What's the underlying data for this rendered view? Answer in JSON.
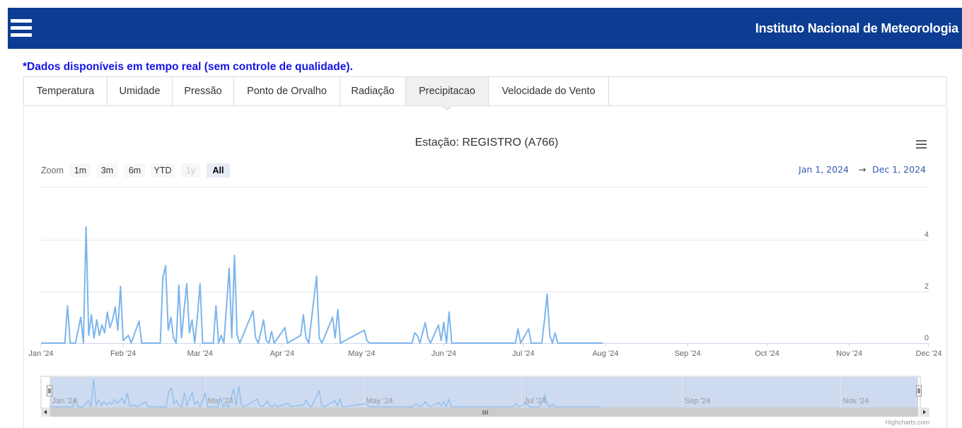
{
  "header": {
    "title": "Instituto Nacional de Meteorologia",
    "menu_icon": "hamburger-menu-icon",
    "background_color": "#0c3d92"
  },
  "notice": "*Dados disponíveis em tempo real (sem controle de qualidade).",
  "tabs": [
    {
      "label": "Temperatura",
      "active": false
    },
    {
      "label": "Umidade",
      "active": false
    },
    {
      "label": "Pressão",
      "active": false
    },
    {
      "label": "Ponto de Orvalho",
      "active": false
    },
    {
      "label": "Radiação",
      "active": false
    },
    {
      "label": "Precipitacao",
      "active": true
    },
    {
      "label": "Velocidade do Vento",
      "active": false
    }
  ],
  "chart_menu_icon": "context-menu-icon",
  "range_selector": {
    "zoom_label": "Zoom",
    "buttons": [
      "1m",
      "3m",
      "6m",
      "YTD",
      "1y",
      "All"
    ],
    "selected": "All",
    "disabled": [
      "1y"
    ]
  },
  "date_range": {
    "from": "Jan 1, 2024",
    "arrow": "→",
    "to": "Dec 1, 2024"
  },
  "credits": "Highcharts.com",
  "chart_data": {
    "type": "line",
    "title": "Estação: REGISTRO (A766)",
    "series_color": "#7cb5ec",
    "x_range": [
      "2024-01-01",
      "2024-12-01"
    ],
    "x_ticks": [
      "Jan '24",
      "Feb '24",
      "Mar '24",
      "Apr '24",
      "May '24",
      "Jun '24",
      "Jul '24",
      "Aug '24",
      "Sep '24",
      "Oct '24",
      "Nov '24",
      "Dec '24"
    ],
    "y_ticks": [
      0,
      2,
      4
    ],
    "ylim": [
      0,
      4
    ],
    "grid": true,
    "navigator_ticks": [
      "Jan '24",
      "Mar '24",
      "May '24",
      "Jul '24",
      "Sep '24",
      "Nov '24"
    ],
    "points": [
      [
        "2024-01-01",
        0
      ],
      [
        "2024-01-10",
        0
      ],
      [
        "2024-01-11",
        1.45
      ],
      [
        "2024-01-12",
        0
      ],
      [
        "2024-01-14",
        0
      ],
      [
        "2024-01-16",
        1.0
      ],
      [
        "2024-01-17",
        0
      ],
      [
        "2024-01-18",
        4.5
      ],
      [
        "2024-01-19",
        0.3
      ],
      [
        "2024-01-20",
        1.1
      ],
      [
        "2024-01-21",
        0.2
      ],
      [
        "2024-01-22",
        0.9
      ],
      [
        "2024-01-23",
        0.3
      ],
      [
        "2024-01-24",
        0.7
      ],
      [
        "2024-01-25",
        0.4
      ],
      [
        "2024-01-26",
        1.2
      ],
      [
        "2024-01-27",
        0.6
      ],
      [
        "2024-01-28",
        0.9
      ],
      [
        "2024-01-29",
        1.4
      ],
      [
        "2024-01-30",
        0.5
      ],
      [
        "2024-01-31",
        2.2
      ],
      [
        "2024-02-01",
        0.1
      ],
      [
        "2024-02-03",
        0.3
      ],
      [
        "2024-02-04",
        0
      ],
      [
        "2024-02-07",
        0.85
      ],
      [
        "2024-02-08",
        0
      ],
      [
        "2024-02-15",
        0
      ],
      [
        "2024-02-16",
        2.55
      ],
      [
        "2024-02-17",
        3.0
      ],
      [
        "2024-02-18",
        0.5
      ],
      [
        "2024-02-19",
        1.0
      ],
      [
        "2024-02-20",
        0.2
      ],
      [
        "2024-02-21",
        0
      ],
      [
        "2024-02-22",
        2.25
      ],
      [
        "2024-02-23",
        0.2
      ],
      [
        "2024-02-24",
        1.3
      ],
      [
        "2024-02-25",
        2.3
      ],
      [
        "2024-02-26",
        0.4
      ],
      [
        "2024-02-27",
        0.9
      ],
      [
        "2024-02-28",
        0
      ],
      [
        "2024-02-29",
        1.0
      ],
      [
        "2024-03-01",
        2.3
      ],
      [
        "2024-03-02",
        0
      ],
      [
        "2024-03-06",
        0
      ],
      [
        "2024-03-07",
        1.45
      ],
      [
        "2024-03-08",
        0
      ],
      [
        "2024-03-09",
        0.3
      ],
      [
        "2024-03-10",
        0
      ],
      [
        "2024-03-12",
        2.9
      ],
      [
        "2024-03-13",
        0.2
      ],
      [
        "2024-03-14",
        3.4
      ],
      [
        "2024-03-15",
        0.3
      ],
      [
        "2024-03-16",
        0
      ],
      [
        "2024-03-21",
        1.25
      ],
      [
        "2024-03-22",
        0.2
      ],
      [
        "2024-03-23",
        0
      ],
      [
        "2024-03-25",
        0.9
      ],
      [
        "2024-03-26",
        0.1
      ],
      [
        "2024-03-27",
        0
      ],
      [
        "2024-03-28",
        0.45
      ],
      [
        "2024-03-29",
        0
      ],
      [
        "2024-04-02",
        0.6
      ],
      [
        "2024-04-03",
        0
      ],
      [
        "2024-04-08",
        0.3
      ],
      [
        "2024-04-09",
        1.1
      ],
      [
        "2024-04-10",
        0.2
      ],
      [
        "2024-04-11",
        0
      ],
      [
        "2024-04-14",
        2.6
      ],
      [
        "2024-04-15",
        0.2
      ],
      [
        "2024-04-16",
        0
      ],
      [
        "2024-04-20",
        1.0
      ],
      [
        "2024-04-21",
        0.2
      ],
      [
        "2024-04-22",
        1.3
      ],
      [
        "2024-04-23",
        0
      ],
      [
        "2024-05-02",
        0.5
      ],
      [
        "2024-05-03",
        0.1
      ],
      [
        "2024-05-04",
        0
      ],
      [
        "2024-05-20",
        0
      ],
      [
        "2024-05-21",
        0.4
      ],
      [
        "2024-05-22",
        0.3
      ],
      [
        "2024-05-23",
        0
      ],
      [
        "2024-05-25",
        0.8
      ],
      [
        "2024-05-26",
        0.2
      ],
      [
        "2024-05-27",
        0
      ],
      [
        "2024-05-30",
        0.7
      ],
      [
        "2024-05-31",
        0.1
      ],
      [
        "2024-06-01",
        0.8
      ],
      [
        "2024-06-02",
        0
      ],
      [
        "2024-06-03",
        1.2
      ],
      [
        "2024-06-04",
        0
      ],
      [
        "2024-06-28",
        0
      ],
      [
        "2024-06-29",
        0.55
      ],
      [
        "2024-06-30",
        0
      ],
      [
        "2024-07-03",
        0.55
      ],
      [
        "2024-07-04",
        0
      ],
      [
        "2024-07-08",
        0
      ],
      [
        "2024-07-09",
        0.9
      ],
      [
        "2024-07-10",
        1.9
      ],
      [
        "2024-07-11",
        0.3
      ],
      [
        "2024-07-12",
        0
      ],
      [
        "2024-07-13",
        0.4
      ],
      [
        "2024-07-14",
        0
      ],
      [
        "2024-07-31",
        0
      ]
    ]
  }
}
